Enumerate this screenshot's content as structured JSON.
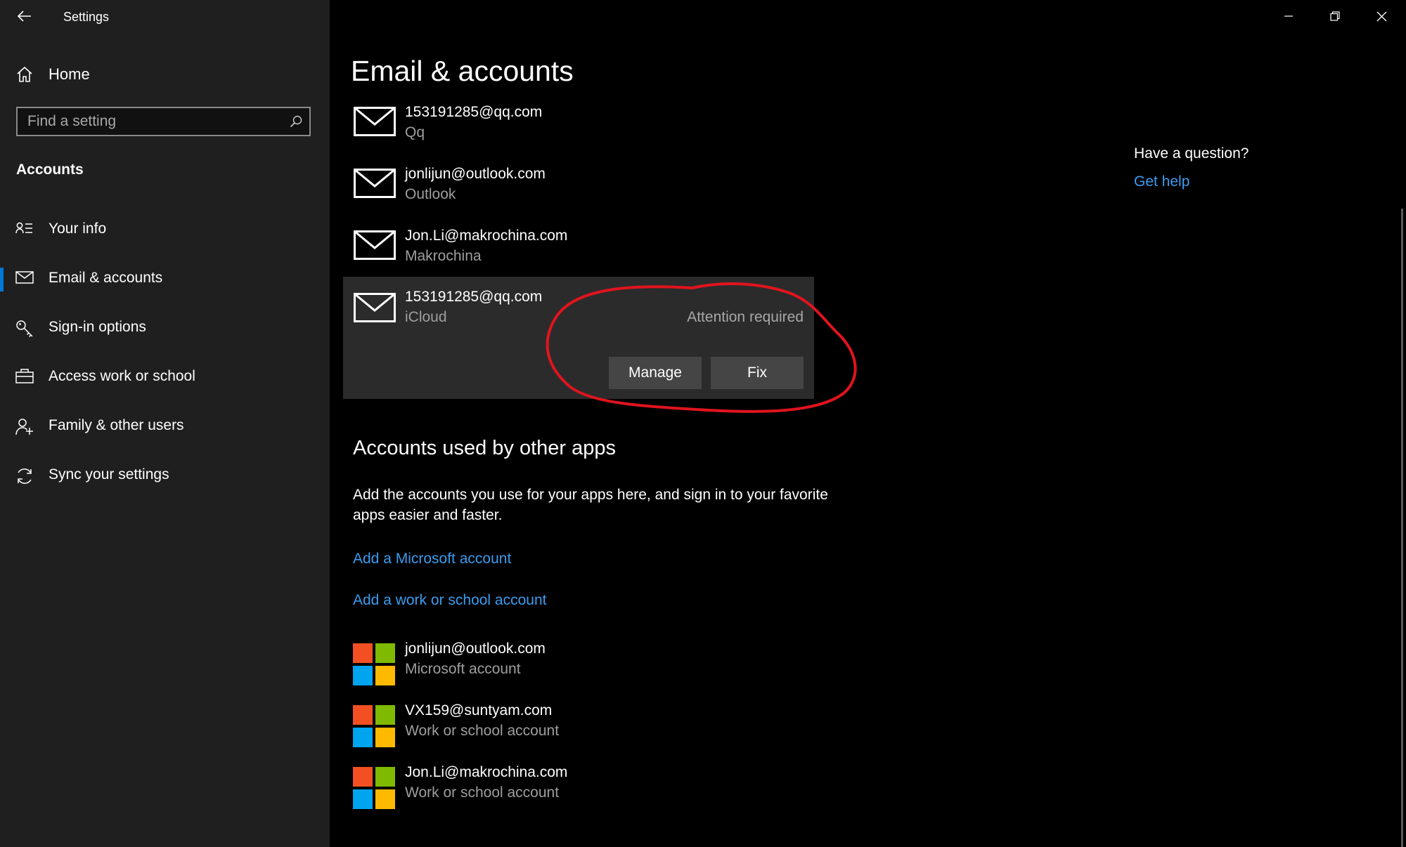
{
  "window": {
    "title": "Settings",
    "controls": {
      "minimize": "minimize-icon",
      "restore": "restore-icon",
      "close": "close-icon"
    }
  },
  "sidebar": {
    "home_label": "Home",
    "search_placeholder": "Find a setting",
    "section_heading": "Accounts",
    "items": [
      {
        "label": "Your info",
        "icon": "contact-card-icon",
        "selected": false
      },
      {
        "label": "Email & accounts",
        "icon": "mail-icon",
        "selected": true
      },
      {
        "label": "Sign-in options",
        "icon": "key-icon",
        "selected": false
      },
      {
        "label": "Access work or school",
        "icon": "briefcase-icon",
        "selected": false
      },
      {
        "label": "Family & other users",
        "icon": "add-user-icon",
        "selected": false
      },
      {
        "label": "Sync your settings",
        "icon": "sync-icon",
        "selected": false
      }
    ]
  },
  "main": {
    "title": "Email & accounts",
    "email_accounts": [
      {
        "address": "153191285@qq.com",
        "provider": "Qq"
      },
      {
        "address": "jonlijun@outlook.com",
        "provider": "Outlook"
      },
      {
        "address": "Jon.Li@makrochina.com",
        "provider": "Makrochina"
      },
      {
        "address": "153191285@qq.com",
        "provider": "iCloud",
        "expanded": true,
        "status": "Attention required",
        "manage_label": "Manage",
        "fix_label": "Fix"
      }
    ],
    "other_apps": {
      "heading": "Accounts used by other apps",
      "description": "Add the accounts you use for your apps here, and sign in to your favorite apps easier and faster.",
      "add_microsoft_link": "Add a Microsoft account",
      "add_work_link": "Add a work or school account",
      "accounts": [
        {
          "address": "jonlijun@outlook.com",
          "type": "Microsoft account"
        },
        {
          "address": "VX159@suntyam.com",
          "type": "Work or school account"
        },
        {
          "address": "Jon.Li@makrochina.com",
          "type": "Work or school account"
        }
      ]
    }
  },
  "help": {
    "heading": "Have a question?",
    "link": "Get help"
  },
  "colors": {
    "sidebar_bg": "#1f1f1f",
    "main_bg": "#000000",
    "accent": "#0078d7",
    "link": "#3b9cf0",
    "card_bg": "#2b2b2b",
    "button_bg": "#454545",
    "annotation": "#e0141e",
    "ms_logo": [
      "#f25022",
      "#7fba00",
      "#00a4ef",
      "#ffb900"
    ]
  }
}
